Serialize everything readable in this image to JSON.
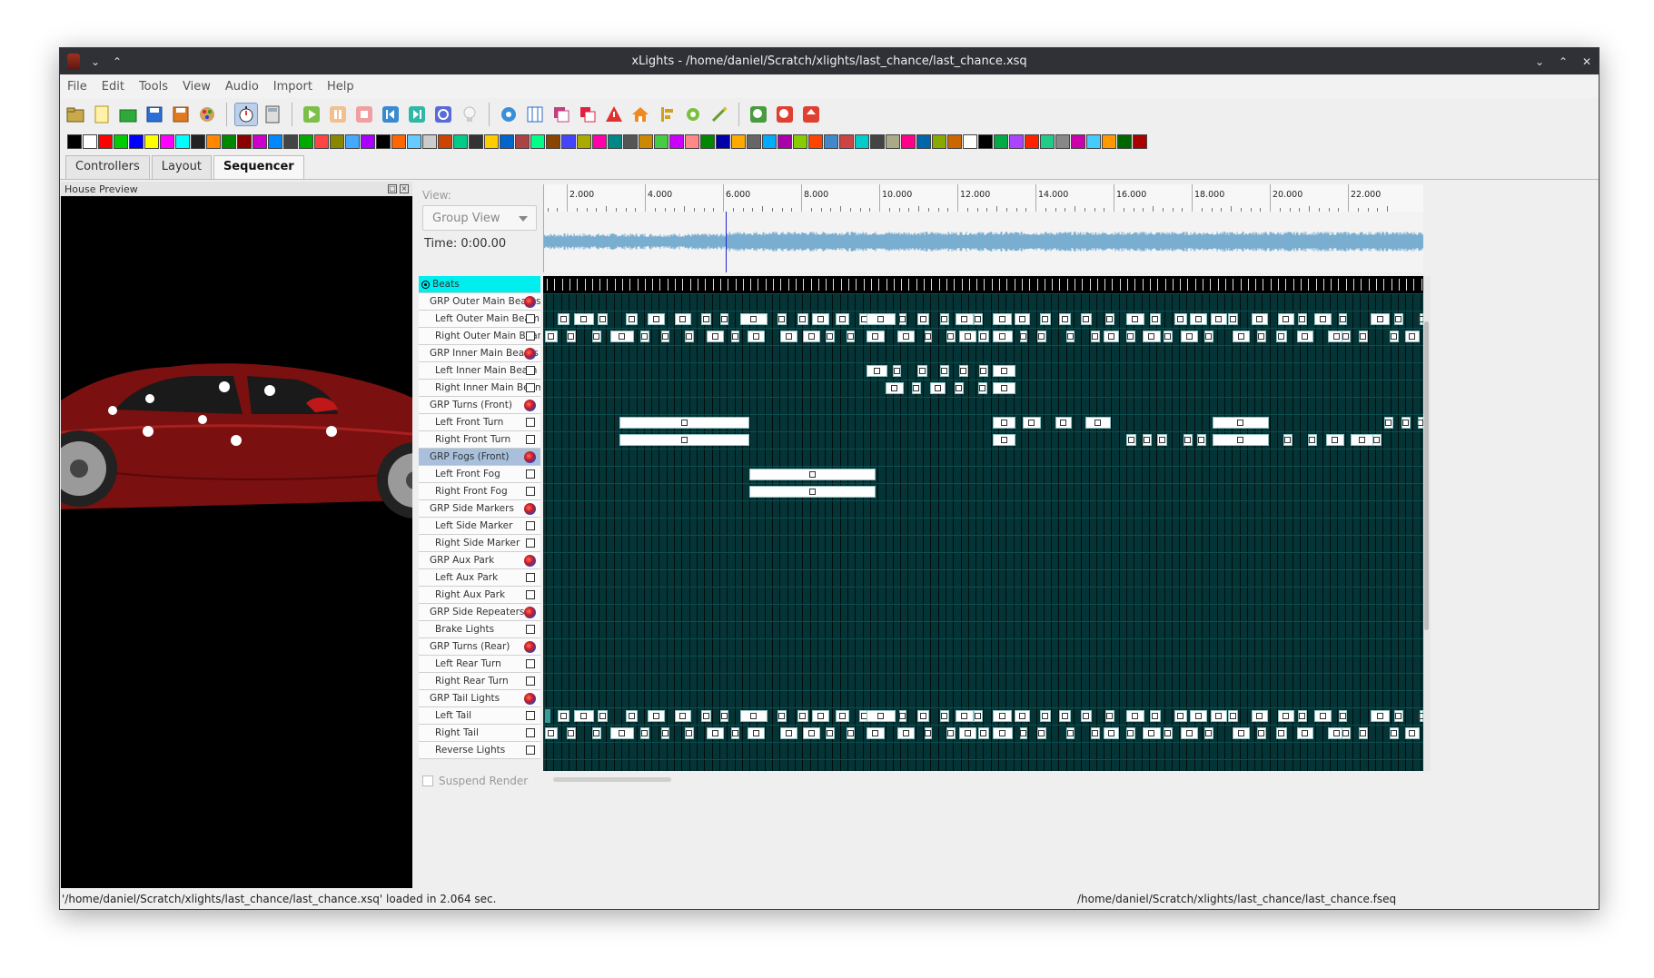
{
  "window": {
    "title": "xLights - /home/daniel/Scratch/xlights/last_chance/last_chance.xsq"
  },
  "menu": [
    "File",
    "Edit",
    "Tools",
    "View",
    "Audio",
    "Import",
    "Help"
  ],
  "tabs": [
    {
      "label": "Controllers",
      "active": false
    },
    {
      "label": "Layout",
      "active": false
    },
    {
      "label": "Sequencer",
      "active": true
    }
  ],
  "preview": {
    "title": "House Preview"
  },
  "sequencer": {
    "view_label": "View:",
    "view_select": "Group View",
    "time_label": "Time: 0:00.00",
    "suspend_render": "Suspend Render",
    "timeline_labels": [
      "2.000",
      "4.000",
      "6.000",
      "8.000",
      "10.000",
      "12.000",
      "14.000",
      "16.000",
      "18.000",
      "20.000",
      "22.000"
    ],
    "rows": [
      {
        "label": "Beats",
        "kind": "timing"
      },
      {
        "label": "GRP Outer Main Beams",
        "kind": "group"
      },
      {
        "label": "Left Outer Main Beam",
        "kind": "model"
      },
      {
        "label": "Right Outer Main Beam",
        "kind": "model"
      },
      {
        "label": "GRP Inner Main Beams",
        "kind": "group"
      },
      {
        "label": "Left Inner Main Beam",
        "kind": "model"
      },
      {
        "label": "Right Inner Main Beam",
        "kind": "model"
      },
      {
        "label": "GRP Turns (Front)",
        "kind": "group"
      },
      {
        "label": "Left Front Turn",
        "kind": "model"
      },
      {
        "label": "Right Front Turn",
        "kind": "model"
      },
      {
        "label": "GRP Fogs (Front)",
        "kind": "group",
        "selected": true
      },
      {
        "label": "Left Front Fog",
        "kind": "model"
      },
      {
        "label": "Right Front Fog",
        "kind": "model"
      },
      {
        "label": "GRP Side Markers",
        "kind": "group"
      },
      {
        "label": "Left Side Marker",
        "kind": "model"
      },
      {
        "label": "Right Side Marker",
        "kind": "model"
      },
      {
        "label": "GRP Aux Park",
        "kind": "group"
      },
      {
        "label": "Left Aux Park",
        "kind": "model"
      },
      {
        "label": "Right Aux Park",
        "kind": "model"
      },
      {
        "label": "GRP Side Repeaters",
        "kind": "group"
      },
      {
        "label": "Brake Lights",
        "kind": "model"
      },
      {
        "label": "GRP Turns (Rear)",
        "kind": "group"
      },
      {
        "label": "Left Rear Turn",
        "kind": "model"
      },
      {
        "label": "Right Rear Turn",
        "kind": "model"
      },
      {
        "label": "GRP Tail Lights",
        "kind": "group"
      },
      {
        "label": "Left Tail",
        "kind": "model"
      },
      {
        "label": "Right Tail",
        "kind": "model"
      },
      {
        "label": "Reverse Lights",
        "kind": "model"
      }
    ]
  },
  "status": {
    "left": "'/home/daniel/Scratch/xlights/last_chance/last_chance.xsq' loaded in 2.064 sec.",
    "right": "/home/daniel/Scratch/xlights/last_chance/last_chance.fseq"
  },
  "colors": {
    "timing_row": "#00eeee",
    "grid_bg": "#053436",
    "waveform": "#7aaed0",
    "cursor": "#2222cc",
    "car_body": "#8a1212"
  }
}
